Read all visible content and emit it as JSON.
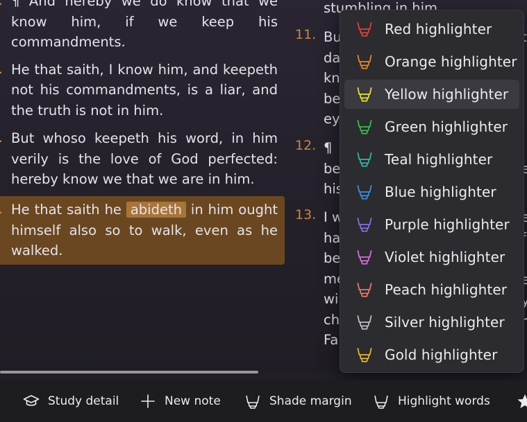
{
  "left_column": {
    "verse_3_number": ".",
    "verse_3_text": "¶ And hereby we do know that we know him, if we keep his commandments.",
    "verse_4_number": ".",
    "verse_4_text": "He that saith, I know him, and keepeth not his commandments, is a liar, and the truth is not in him.",
    "verse_5_number": ".",
    "verse_5_text": "But whoso keepeth his word, in him verily is the love of God perfected: hereby know we that we are in him.",
    "verse_6_number": ".",
    "verse_6_before": "He that saith he ",
    "verse_6_highlight": "abideth",
    "verse_6_after": " in him ought himself also so to walk, even as he walked."
  },
  "right_column": {
    "top_fragment": "stumbling in him.",
    "verse_11_number": "11.",
    "verse_11_lines": [
      "Bu",
      "da",
      "kn",
      "be",
      "ey"
    ],
    "verse_12_number": "12.",
    "verse_12_lines": [
      "¶",
      "be",
      "his"
    ],
    "verse_13_number": "13.",
    "verse_13_lines": [
      "I w",
      "ha",
      "be",
      "me",
      "wi",
      "ch",
      "Fa"
    ],
    "edge_chars": [
      "t",
      "er",
      "e",
      "f",
      "e",
      "y",
      "r"
    ]
  },
  "highlighter_menu": {
    "items": [
      {
        "label": "Red highlighter",
        "color": "#e0433f"
      },
      {
        "label": "Orange highlighter",
        "color": "#e8862c"
      },
      {
        "label": "Yellow highlighter",
        "color": "#e9e33a"
      },
      {
        "label": "Green highlighter",
        "color": "#3dbb50"
      },
      {
        "label": "Teal highlighter",
        "color": "#33b8a8"
      },
      {
        "label": "Blue highlighter",
        "color": "#3c8fe0"
      },
      {
        "label": "Purple highlighter",
        "color": "#8a6fe0"
      },
      {
        "label": "Violet highlighter",
        "color": "#d770d6"
      },
      {
        "label": "Peach highlighter",
        "color": "#ea7a6c"
      },
      {
        "label": "Silver highlighter",
        "color": "#bdbdc3"
      },
      {
        "label": "Gold highlighter",
        "color": "#e2b93a"
      }
    ],
    "selected": "Yellow highlighter"
  },
  "toolbar": {
    "study_detail": "Study detail",
    "new_note": "New note",
    "shade_margin": "Shade margin",
    "highlight_words": "Highlight words"
  },
  "colors": {
    "accent": "#c8873e",
    "highlight_block": "#6a4720",
    "word_highlight": "#a8743a"
  }
}
